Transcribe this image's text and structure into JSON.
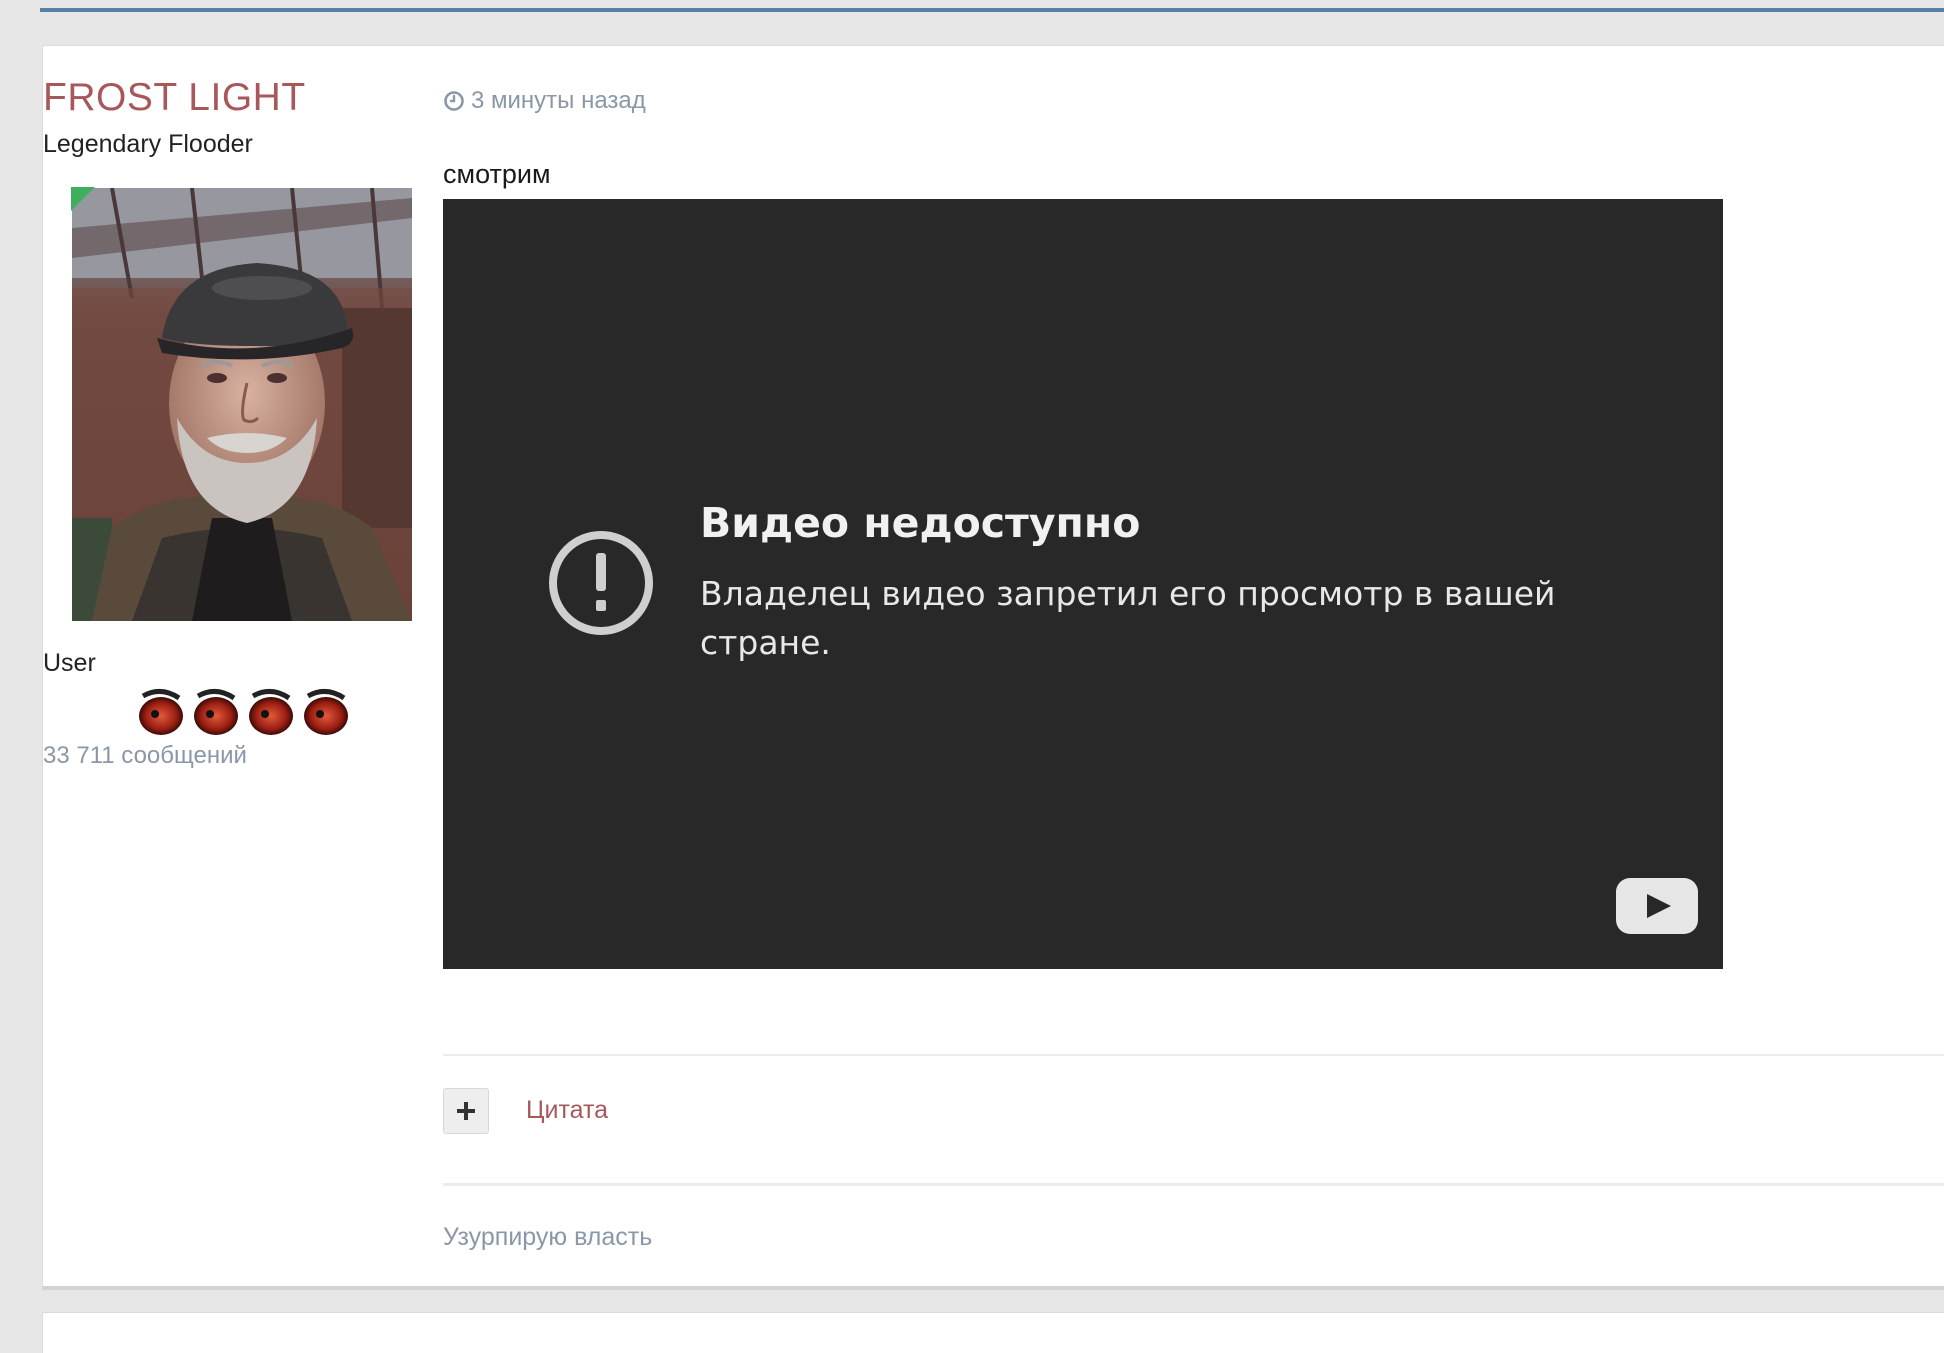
{
  "post": {
    "author": {
      "name": "FROST LIGHT",
      "title": "Legendary Flooder",
      "group": "User",
      "posts_count": "33 711 сообщений",
      "rank_icon_count": 4,
      "online": true
    },
    "time": "3 минуты назад",
    "text": "смотрим",
    "video": {
      "title": "Видео недоступно",
      "message": "Владелец видео запретил его просмотр в вашей стране."
    },
    "actions": {
      "quote_label": "Цитата"
    },
    "signature": "Узурпирую власть"
  },
  "colors": {
    "accent": "#a8575a",
    "muted": "#8a97a7",
    "video_bg": "#282828",
    "online": "#3fae5f"
  },
  "icons": {
    "time": "clock-icon",
    "video_alert": "exclamation-circle-icon",
    "video_logo": "youtube-play-icon",
    "multiquote": "plus-icon"
  }
}
